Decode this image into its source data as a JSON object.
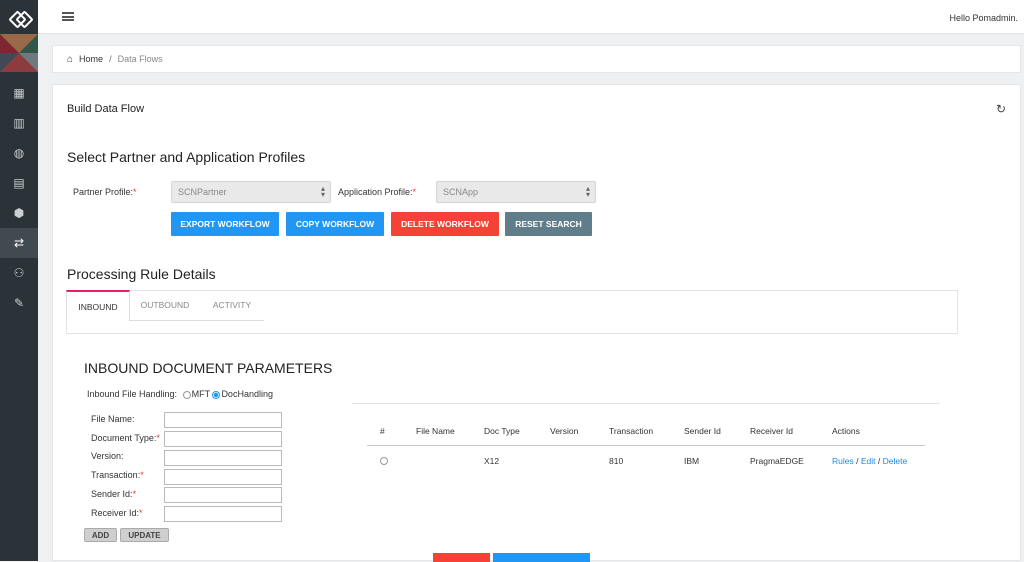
{
  "app": {
    "greeting": "Hello Pomadmin."
  },
  "sidebar": {
    "icons": [
      "logo-icon",
      "table-icon",
      "bar-chart-icon",
      "globe-icon",
      "file-chart-icon",
      "cube-icon",
      "exchange-icon",
      "users-icon",
      "wrench-icon"
    ],
    "active_index": 6
  },
  "breadcrumb": {
    "home": "Home",
    "separator": "/",
    "current": "Data Flows"
  },
  "panel": {
    "title": "Build Data Flow"
  },
  "profiles": {
    "heading": "Select Partner and Application Profiles",
    "partner_label": "Partner Profile:",
    "partner_value": "SCNPartner",
    "application_label": "Application Profile:",
    "application_value": "SCNApp",
    "required_mark": "*"
  },
  "actions": {
    "export": "EXPORT WORKFLOW",
    "copy": "COPY WORKFLOW",
    "delete": "DELETE WORKFLOW",
    "reset": "RESET SEARCH"
  },
  "rules": {
    "heading": "Processing Rule Details",
    "tabs": [
      "INBOUND",
      "OUTBOUND",
      "ACTIVITY"
    ],
    "active_tab": "INBOUND"
  },
  "inbound": {
    "heading": "INBOUND DOCUMENT PARAMETERS",
    "handling_label": "Inbound File Handling:",
    "option_mft": "MFT",
    "option_doc": "DocHandling",
    "selected": "DocHandling",
    "fields": [
      {
        "label": "File Name:",
        "required": false
      },
      {
        "label": "Document Type:",
        "required": true
      },
      {
        "label": "Version:",
        "required": false
      },
      {
        "label": "Transaction:",
        "required": true
      },
      {
        "label": "Sender Id:",
        "required": true
      },
      {
        "label": "Receiver Id:",
        "required": true
      }
    ],
    "add_label": "ADD",
    "update_label": "UPDATE"
  },
  "table": {
    "headers": [
      "#",
      "File Name",
      "Doc Type",
      "Version",
      "Transaction",
      "Sender Id",
      "Receiver Id",
      "Actions"
    ],
    "rows": [
      {
        "file_name": "",
        "doc_type": "X12",
        "version": "",
        "transaction": "810",
        "sender": "IBM",
        "receiver": "PragmaEDGE",
        "rules": "Rules",
        "edit": "Edit",
        "delete": "Delete",
        "sep": "/"
      }
    ]
  },
  "colors": {
    "primary": "#2196f3",
    "danger": "#f44336",
    "neutral": "#607d8b",
    "sidebar": "#2b3338",
    "tab_accent": "#e91e63"
  }
}
